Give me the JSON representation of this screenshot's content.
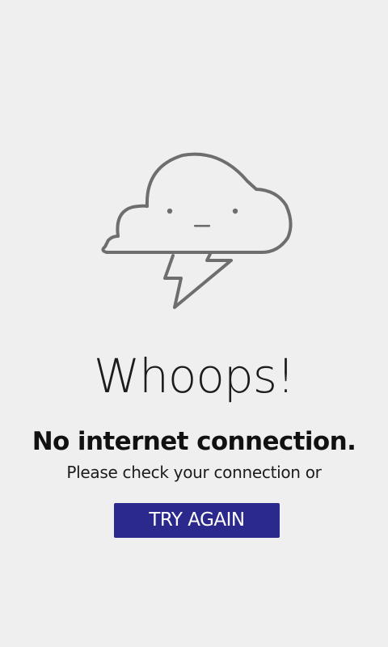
{
  "message": {
    "headline": "Whoops!",
    "subheadline": "No internet connection.",
    "hint": "Please check your connection or"
  },
  "retry": {
    "label": "TRY AGAIN"
  },
  "illustration": {
    "icon": "storm-cloud-icon",
    "stroke_color": "#6e6e6e"
  },
  "colors": {
    "background": "#efefef",
    "button": "#2b2a8c",
    "text": "#1c1c1c"
  }
}
